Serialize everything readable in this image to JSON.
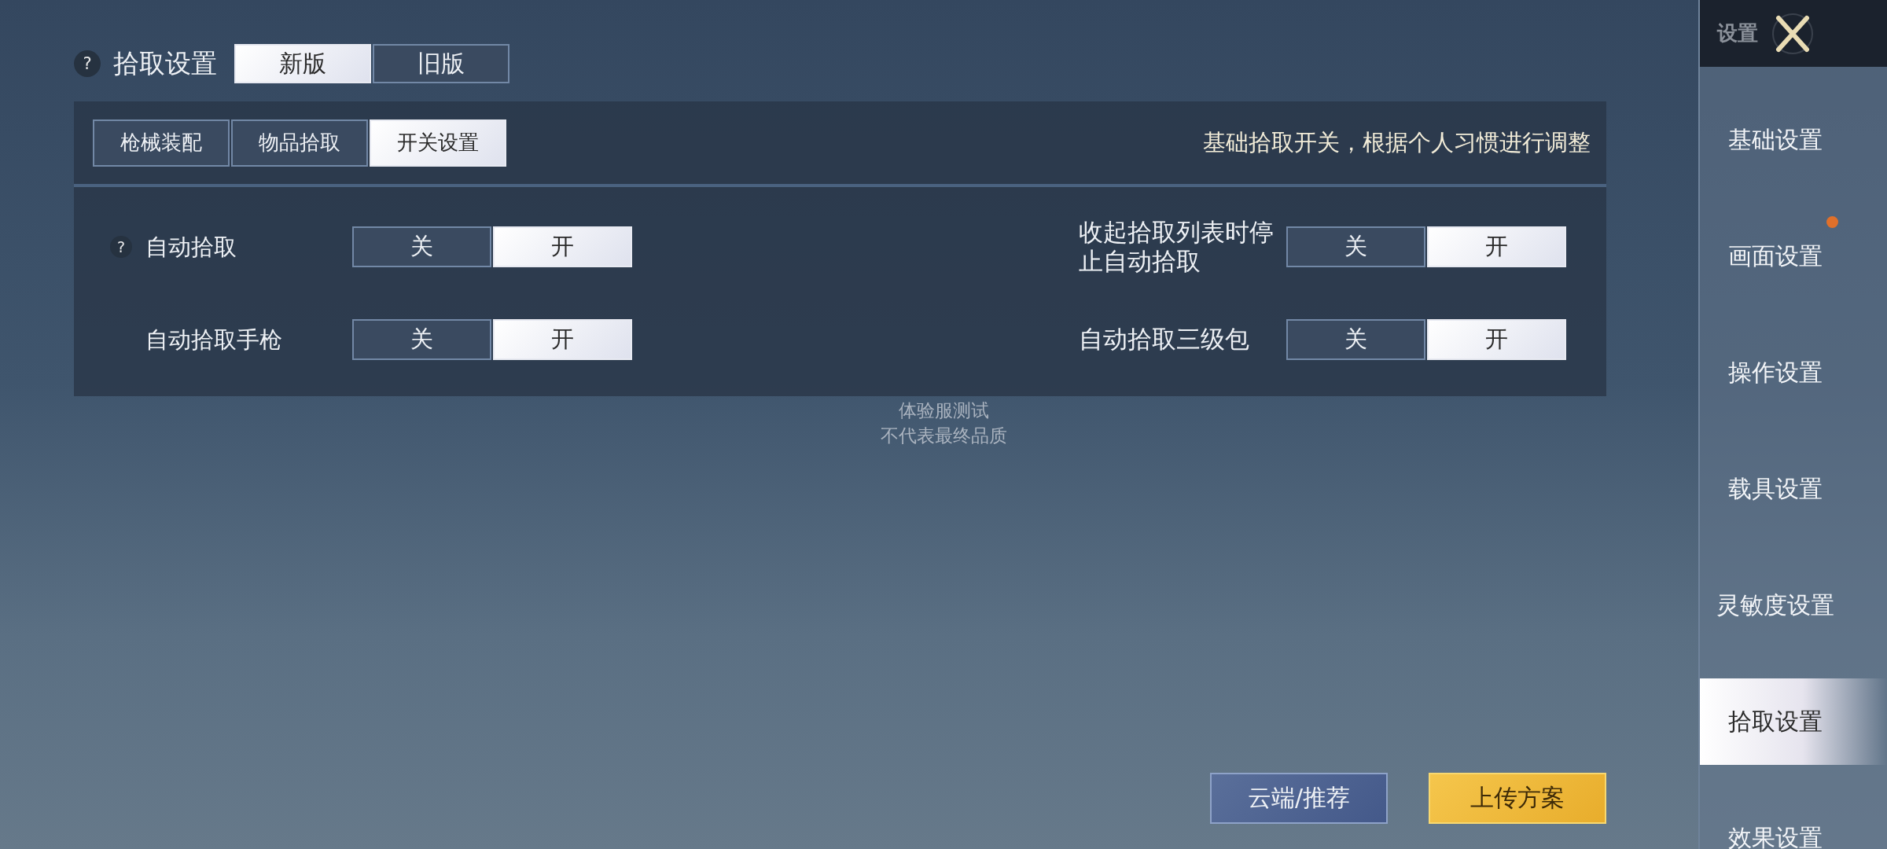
{
  "header": {
    "help": "?",
    "title": "拾取设置",
    "versions": [
      {
        "label": "新版",
        "selected": true
      },
      {
        "label": "旧版",
        "selected": false
      }
    ]
  },
  "sub_tabs": [
    {
      "label": "枪械装配",
      "selected": false
    },
    {
      "label": "物品拾取",
      "selected": false
    },
    {
      "label": "开关设置",
      "selected": true
    }
  ],
  "description": "基础拾取开关，根据个人习惯进行调整",
  "option_rows": [
    [
      {
        "help": "?",
        "label": "自动拾取",
        "choices": [
          {
            "label": "关",
            "selected": false
          },
          {
            "label": "开",
            "selected": true
          }
        ]
      },
      {
        "label": "收起拾取列表时停止自动拾取",
        "choices": [
          {
            "label": "关",
            "selected": false
          },
          {
            "label": "开",
            "selected": true
          }
        ]
      }
    ],
    [
      {
        "label": "自动拾取手枪",
        "choices": [
          {
            "label": "关",
            "selected": false
          },
          {
            "label": "开",
            "selected": true
          }
        ]
      },
      {
        "label": "自动拾取三级包",
        "choices": [
          {
            "label": "关",
            "selected": false
          },
          {
            "label": "开",
            "selected": true
          }
        ]
      }
    ]
  ],
  "notice_lines": [
    "体验服测试",
    "不代表最终品质"
  ],
  "buttons": [
    {
      "label": "云端/推荐",
      "kind": "secondary"
    },
    {
      "label": "上传方案",
      "kind": "primary"
    }
  ],
  "sidebar": {
    "title": "设置",
    "items": [
      {
        "label": "基础设置",
        "selected": false,
        "notification": false
      },
      {
        "label": "画面设置",
        "selected": false,
        "notification": true
      },
      {
        "label": "操作设置",
        "selected": false,
        "notification": false
      },
      {
        "label": "载具设置",
        "selected": false,
        "notification": false
      },
      {
        "label": "灵敏度设置",
        "selected": false,
        "notification": false
      },
      {
        "label": "拾取设置",
        "selected": true,
        "notification": false
      },
      {
        "label": "效果设置",
        "selected": false,
        "notification": false
      }
    ]
  }
}
